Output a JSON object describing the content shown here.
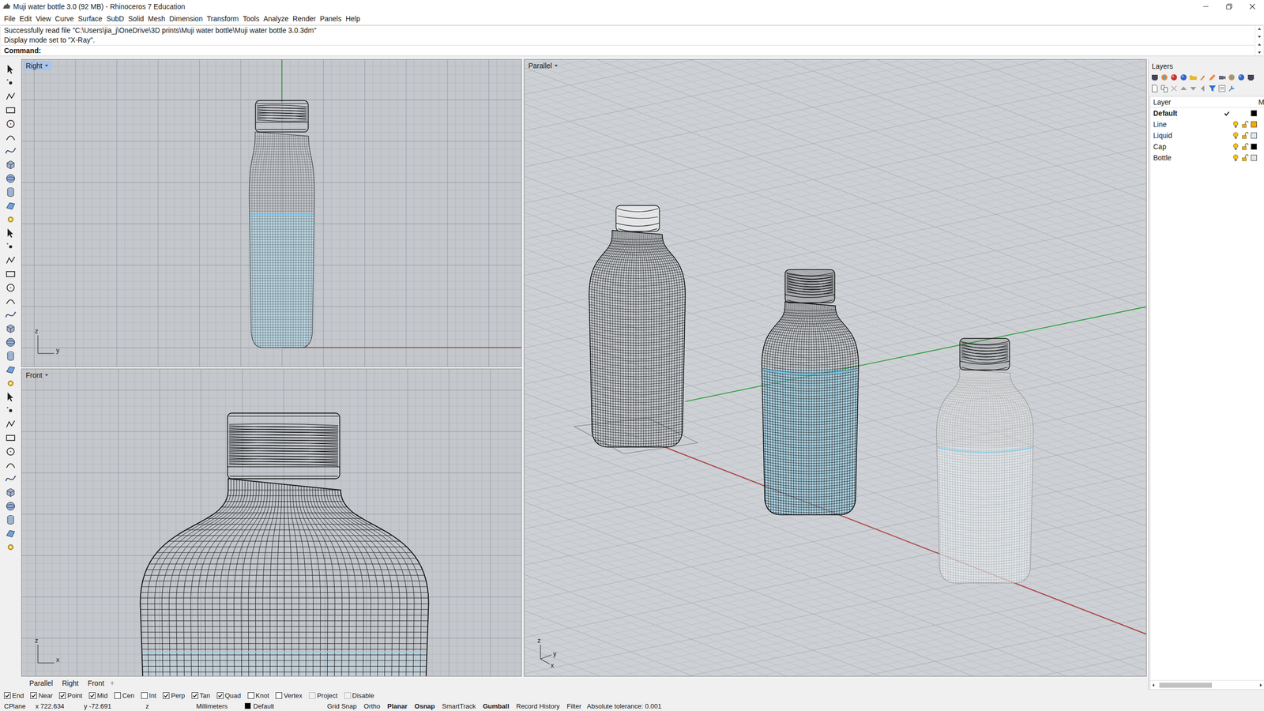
{
  "window": {
    "title": "Muji water bottle 3.0 (92 MB) - Rhinoceros 7 Education"
  },
  "menu": [
    "File",
    "Edit",
    "View",
    "Curve",
    "Surface",
    "SubD",
    "Solid",
    "Mesh",
    "Dimension",
    "Transform",
    "Tools",
    "Analyze",
    "Render",
    "Panels",
    "Help"
  ],
  "command": {
    "history": [
      "Successfully read file \"C:\\Users\\jia_j\\OneDrive\\3D prints\\Muji water bottle\\Muji water bottle 3.0.3dm\"",
      "Display mode set to \"X-Ray\"."
    ],
    "prompt": "Command:",
    "value": ""
  },
  "viewports": [
    {
      "name": "Right",
      "active": true,
      "axes": [
        "z",
        "y"
      ]
    },
    {
      "name": "Front",
      "active": false,
      "axes": [
        "z",
        "x"
      ]
    },
    {
      "name": "Parallel",
      "active": false,
      "axes": [
        "z",
        "y",
        "x"
      ]
    }
  ],
  "viewport_tabs": [
    {
      "label": "Parallel",
      "selected": false
    },
    {
      "label": "Right",
      "selected": false
    },
    {
      "label": "Front",
      "selected": false
    }
  ],
  "osnaps": [
    {
      "label": "End",
      "checked": true,
      "disabled": false
    },
    {
      "label": "Near",
      "checked": true,
      "disabled": false
    },
    {
      "label": "Point",
      "checked": true,
      "disabled": false
    },
    {
      "label": "Mid",
      "checked": true,
      "disabled": false
    },
    {
      "label": "Cen",
      "checked": false,
      "disabled": false
    },
    {
      "label": "Int",
      "checked": false,
      "disabled": false
    },
    {
      "label": "Perp",
      "checked": true,
      "disabled": false
    },
    {
      "label": "Tan",
      "checked": true,
      "disabled": false
    },
    {
      "label": "Quad",
      "checked": true,
      "disabled": false
    },
    {
      "label": "Knot",
      "checked": false,
      "disabled": false
    },
    {
      "label": "Vertex",
      "checked": false,
      "disabled": false
    },
    {
      "label": "Project",
      "checked": false,
      "disabled": true
    },
    {
      "label": "Disable",
      "checked": false,
      "disabled": true
    }
  ],
  "status": {
    "cplane": "CPlane",
    "x": "x 722.634",
    "y": "y -72.691",
    "z": "z",
    "units": "Millimeters",
    "layer": {
      "name": "Default",
      "color": "#000000"
    },
    "toggles": [
      {
        "label": "Grid Snap",
        "on": false
      },
      {
        "label": "Ortho",
        "on": false
      },
      {
        "label": "Planar",
        "on": true
      },
      {
        "label": "Osnap",
        "on": true
      },
      {
        "label": "SmartTrack",
        "on": false
      },
      {
        "label": "Gumball",
        "on": true
      },
      {
        "label": "Record History",
        "on": false
      },
      {
        "label": "Filter",
        "on": false
      }
    ],
    "tolerance": "Absolute tolerance: 0.001"
  },
  "layers": {
    "title": "Layers",
    "columns": [
      "Layer",
      "M"
    ],
    "items": [
      {
        "name": "Default",
        "current": true,
        "color": "#000000"
      },
      {
        "name": "Line",
        "current": false,
        "visible": true,
        "locked": false,
        "color": "#f5a800"
      },
      {
        "name": "Liquid",
        "current": false,
        "visible": true,
        "locked": false,
        "color": "#d6ecf7"
      },
      {
        "name": "Cap",
        "current": false,
        "visible": true,
        "locked": false,
        "color": "#000000"
      },
      {
        "name": "Bottle",
        "current": false,
        "visible": true,
        "locked": false,
        "color": "#e4e4e4"
      }
    ]
  }
}
